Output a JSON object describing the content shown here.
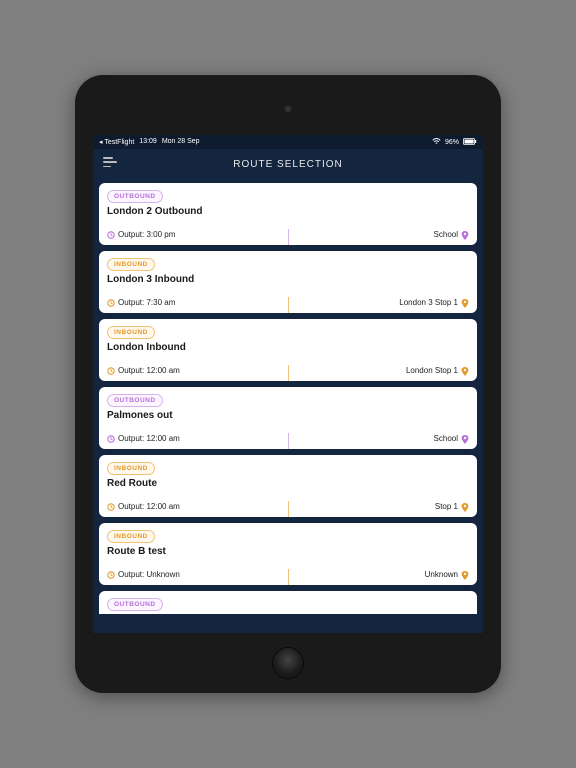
{
  "status": {
    "back_app": "◂ TestFlight",
    "time": "13:09",
    "date": "Mon 28 Sep",
    "battery": "96%"
  },
  "header": {
    "title": "ROUTE SELECTION"
  },
  "routes": [
    {
      "direction": "OUTBOUND",
      "dir_class": "outbound",
      "name": "London 2 Outbound",
      "output": "Output: 3:00 pm",
      "dest": "School"
    },
    {
      "direction": "INBOUND",
      "dir_class": "inbound",
      "name": "London 3 Inbound",
      "output": "Output: 7:30 am",
      "dest": "London 3 Stop 1"
    },
    {
      "direction": "INBOUND",
      "dir_class": "inbound",
      "name": "London Inbound",
      "output": "Output: 12:00 am",
      "dest": "London Stop 1"
    },
    {
      "direction": "OUTBOUND",
      "dir_class": "outbound",
      "name": "Palmones out",
      "output": "Output: 12:00 am",
      "dest": "School"
    },
    {
      "direction": "INBOUND",
      "dir_class": "inbound",
      "name": "Red Route",
      "output": "Output: 12:00 am",
      "dest": "Stop 1"
    },
    {
      "direction": "INBOUND",
      "dir_class": "inbound",
      "name": "Route B test",
      "output": "Output: Unknown",
      "dest": "Unknown"
    }
  ],
  "partial_route": {
    "direction": "OUTBOUND",
    "dir_class": "outbound"
  }
}
